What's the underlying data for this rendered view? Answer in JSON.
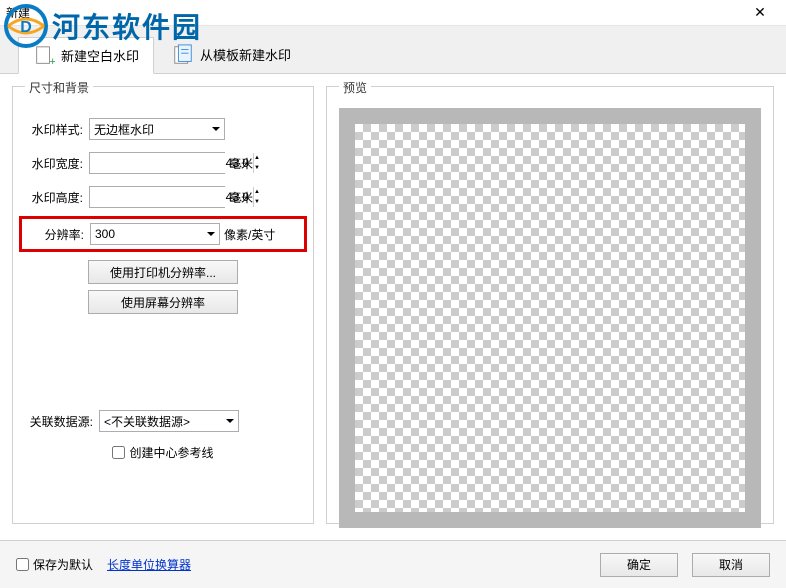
{
  "window": {
    "title": "新建"
  },
  "logo": {
    "text": "河东软件园"
  },
  "tabs": {
    "new_blank": "新建空白水印",
    "from_template": "从模板新建水印"
  },
  "left": {
    "legend": "尺寸和背景",
    "style": {
      "label": "水印样式:",
      "value": "无边框水印"
    },
    "width": {
      "label": "水印宽度:",
      "value": "43.0",
      "unit": "毫米"
    },
    "height": {
      "label": "水印高度:",
      "value": "43.0",
      "unit": "毫米"
    },
    "resolution": {
      "label": "分辨率:",
      "value": "300",
      "unit": "像素/英寸"
    },
    "btn_printer": "使用打印机分辨率...",
    "btn_screen": "使用屏幕分辨率",
    "datasource": {
      "label": "关联数据源:",
      "value": "<不关联数据源>"
    },
    "centerline": "创建中心参考线"
  },
  "right": {
    "legend": "预览"
  },
  "footer": {
    "save_default": "保存为默认",
    "unit_converter": "长度单位换算器",
    "ok": "确定",
    "cancel": "取消"
  }
}
